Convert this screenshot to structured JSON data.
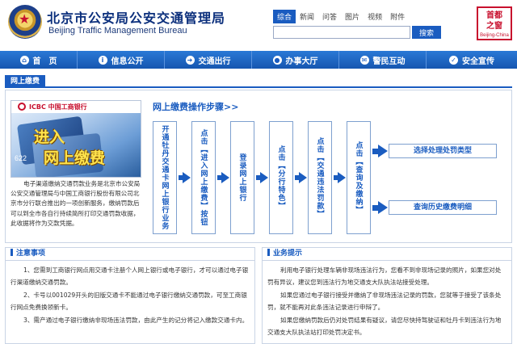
{
  "header": {
    "title_cn": "北京市公安局公安交通管理局",
    "title_en": "Beijing Traffic Management Bureau",
    "logo_right_text": "首都之窗",
    "logo_right_sub": "Beijing-China"
  },
  "search": {
    "tabs": [
      "综合",
      "新闻",
      "问答",
      "图片",
      "视频",
      "附件"
    ],
    "active_tab": "综合",
    "placeholder": "",
    "button_label": "搜索"
  },
  "nav": {
    "items": [
      {
        "label": "首　页",
        "icon": "home-icon"
      },
      {
        "label": "信息公开",
        "icon": "info-icon"
      },
      {
        "label": "交通出行",
        "icon": "travel-icon"
      },
      {
        "label": "办事大厅",
        "icon": "service-hall-icon"
      },
      {
        "label": "警民互动",
        "icon": "interaction-icon"
      },
      {
        "label": "安全宣传",
        "icon": "safety-icon"
      }
    ]
  },
  "tab": {
    "active_label": "网上缴费"
  },
  "banner": {
    "bank_name": "ICBC 中国工商银行",
    "text_line1": "进入",
    "text_line2": "网上缴费",
    "card_number": "622"
  },
  "intro_text": "电子渠道缴纳交通罚款业务是北京市公安局公安交通管理局与中国工商银行股份有限公司北京市分行联合推出的一项创新服务，缴纳罚款后可以到全市各自行持续简所打印交通罚款收据，此收据将作为交款凭据。",
  "flow": {
    "title": "网上缴费操作步骤>>",
    "steps": [
      "开通牡丹交通卡网上银行业务",
      "点击【进入网上缴费】按钮",
      "登录网上银行",
      "点击【分行特色】",
      "点击【交通违法罚款】",
      "点击【查询及缴纳】"
    ],
    "options": [
      "选择处理处罚类型",
      "查询历史缴费明细"
    ]
  },
  "notice": {
    "title": "注意事项",
    "items": [
      "1、您需到工商银行网点用交通卡注册个人网上银行或电子银行，才可以通过电子银行渠道缴纳交通罚款。",
      "2、卡号以001029开头的旧版交通卡不能通过电子银行缴纳交通罚款，可至工商银行网点免费换领新卡。",
      "3、需产通过电子银行缴纳非现场违法罚款，由此产生的记分将记入缴款交通卡内。"
    ]
  },
  "tips": {
    "title": "业务提示",
    "items": [
      "利用电子银行处理车辆非现场违法行为，您看不到非现场记录的照片，如果您对处罚有异议，建议您到违法行为地交通支大队执法站接受处理。",
      "如果您通过电子银行接受并缴纳了非现场违法记录的罚款，您就等于接受了该条处罚，就不能再对此条违法记录进行申辩了。",
      "如果您缴纳罚款后仍对处罚结果有疑议，请您尽快持驾驶证和牡丹卡到违法行为地交通支大队执法站打印处罚决定书。"
    ]
  }
}
